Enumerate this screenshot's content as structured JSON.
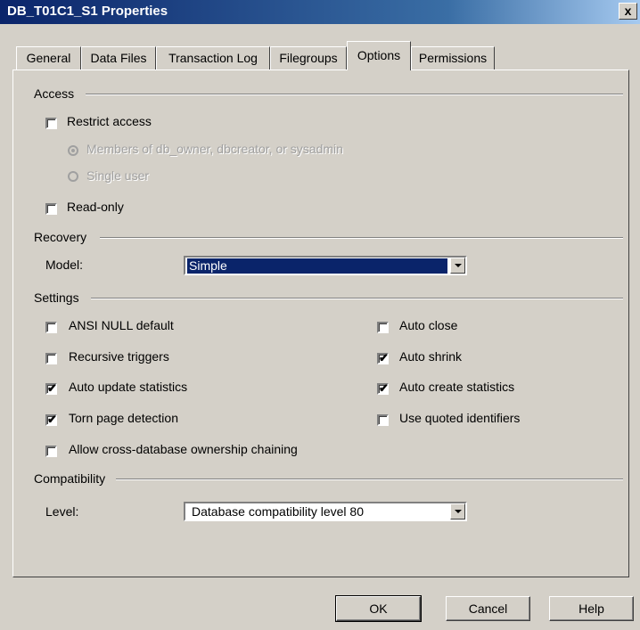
{
  "window": {
    "title": "DB_T01C1_S1 Properties",
    "close_glyph": "x"
  },
  "tabs": [
    {
      "label": "General"
    },
    {
      "label": "Data Files"
    },
    {
      "label": "Transaction Log"
    },
    {
      "label": "Filegroups"
    },
    {
      "label": "Options"
    },
    {
      "label": "Permissions"
    }
  ],
  "active_tab": "Options",
  "access": {
    "heading": "Access",
    "restrict_access": {
      "label": "Restrict access",
      "checked": false
    },
    "radio_members": {
      "label": "Members of db_owner, dbcreator, or sysadmin",
      "selected": true,
      "enabled": false
    },
    "radio_single": {
      "label": "Single user",
      "selected": false,
      "enabled": false
    },
    "read_only": {
      "label": "Read-only",
      "checked": false
    }
  },
  "recovery": {
    "heading": "Recovery",
    "model_label": "Model:",
    "model_value": "Simple"
  },
  "settings": {
    "heading": "Settings",
    "ansi_null_default": {
      "label": "ANSI NULL default",
      "checked": false
    },
    "recursive_triggers": {
      "label": "Recursive triggers",
      "checked": false
    },
    "auto_update_statistics": {
      "label": "Auto update statistics",
      "checked": true
    },
    "torn_page_detection": {
      "label": "Torn page detection",
      "checked": true
    },
    "allow_cross_db": {
      "label": "Allow cross-database ownership chaining",
      "checked": false
    },
    "auto_close": {
      "label": "Auto close",
      "checked": false
    },
    "auto_shrink": {
      "label": "Auto shrink",
      "checked": true
    },
    "auto_create_statistics": {
      "label": "Auto create statistics",
      "checked": true
    },
    "use_quoted_identifiers": {
      "label": "Use quoted identifiers",
      "checked": false
    }
  },
  "compatibility": {
    "heading": "Compatibility",
    "level_label": "Level:",
    "level_value": "Database compatibility level 80"
  },
  "buttons": {
    "ok": "OK",
    "cancel": "Cancel",
    "help": "Help"
  },
  "check_glyph": "✔",
  "colors": {
    "titlebar": "#0a246a",
    "dialog_bg": "#d4d0c8",
    "selection": "#0a246a"
  }
}
